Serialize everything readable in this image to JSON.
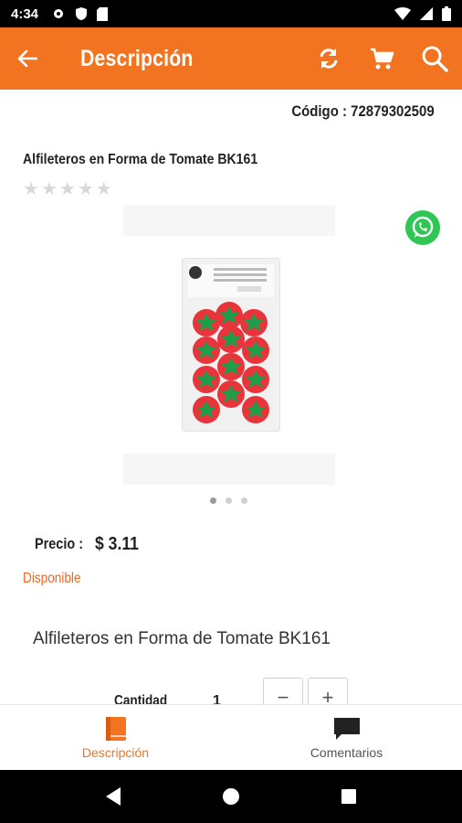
{
  "status_bar": {
    "time": "4:34"
  },
  "app_bar": {
    "title": "Descripción"
  },
  "product": {
    "code_label": "Código : 72879302509",
    "title": "Alfileteros en Forma de Tomate BK161",
    "rating": 0,
    "price_label": "Precio :",
    "price": "$ 3.11",
    "availability": "Disponible",
    "description": "Alfileteros en Forma de Tomate BK161",
    "quantity_label": "Cantidad",
    "quantity": "1",
    "minus": "−",
    "plus": "+"
  },
  "carousel": {
    "count": 3,
    "active": 0
  },
  "bottom_nav": {
    "items": [
      {
        "label": "Descripción",
        "icon": "book-icon",
        "active": true
      },
      {
        "label": "Comentarios",
        "icon": "comment-icon",
        "active": false
      }
    ]
  },
  "colors": {
    "accent": "#f27420",
    "availability": "#f26522",
    "whatsapp": "#2fc653"
  }
}
